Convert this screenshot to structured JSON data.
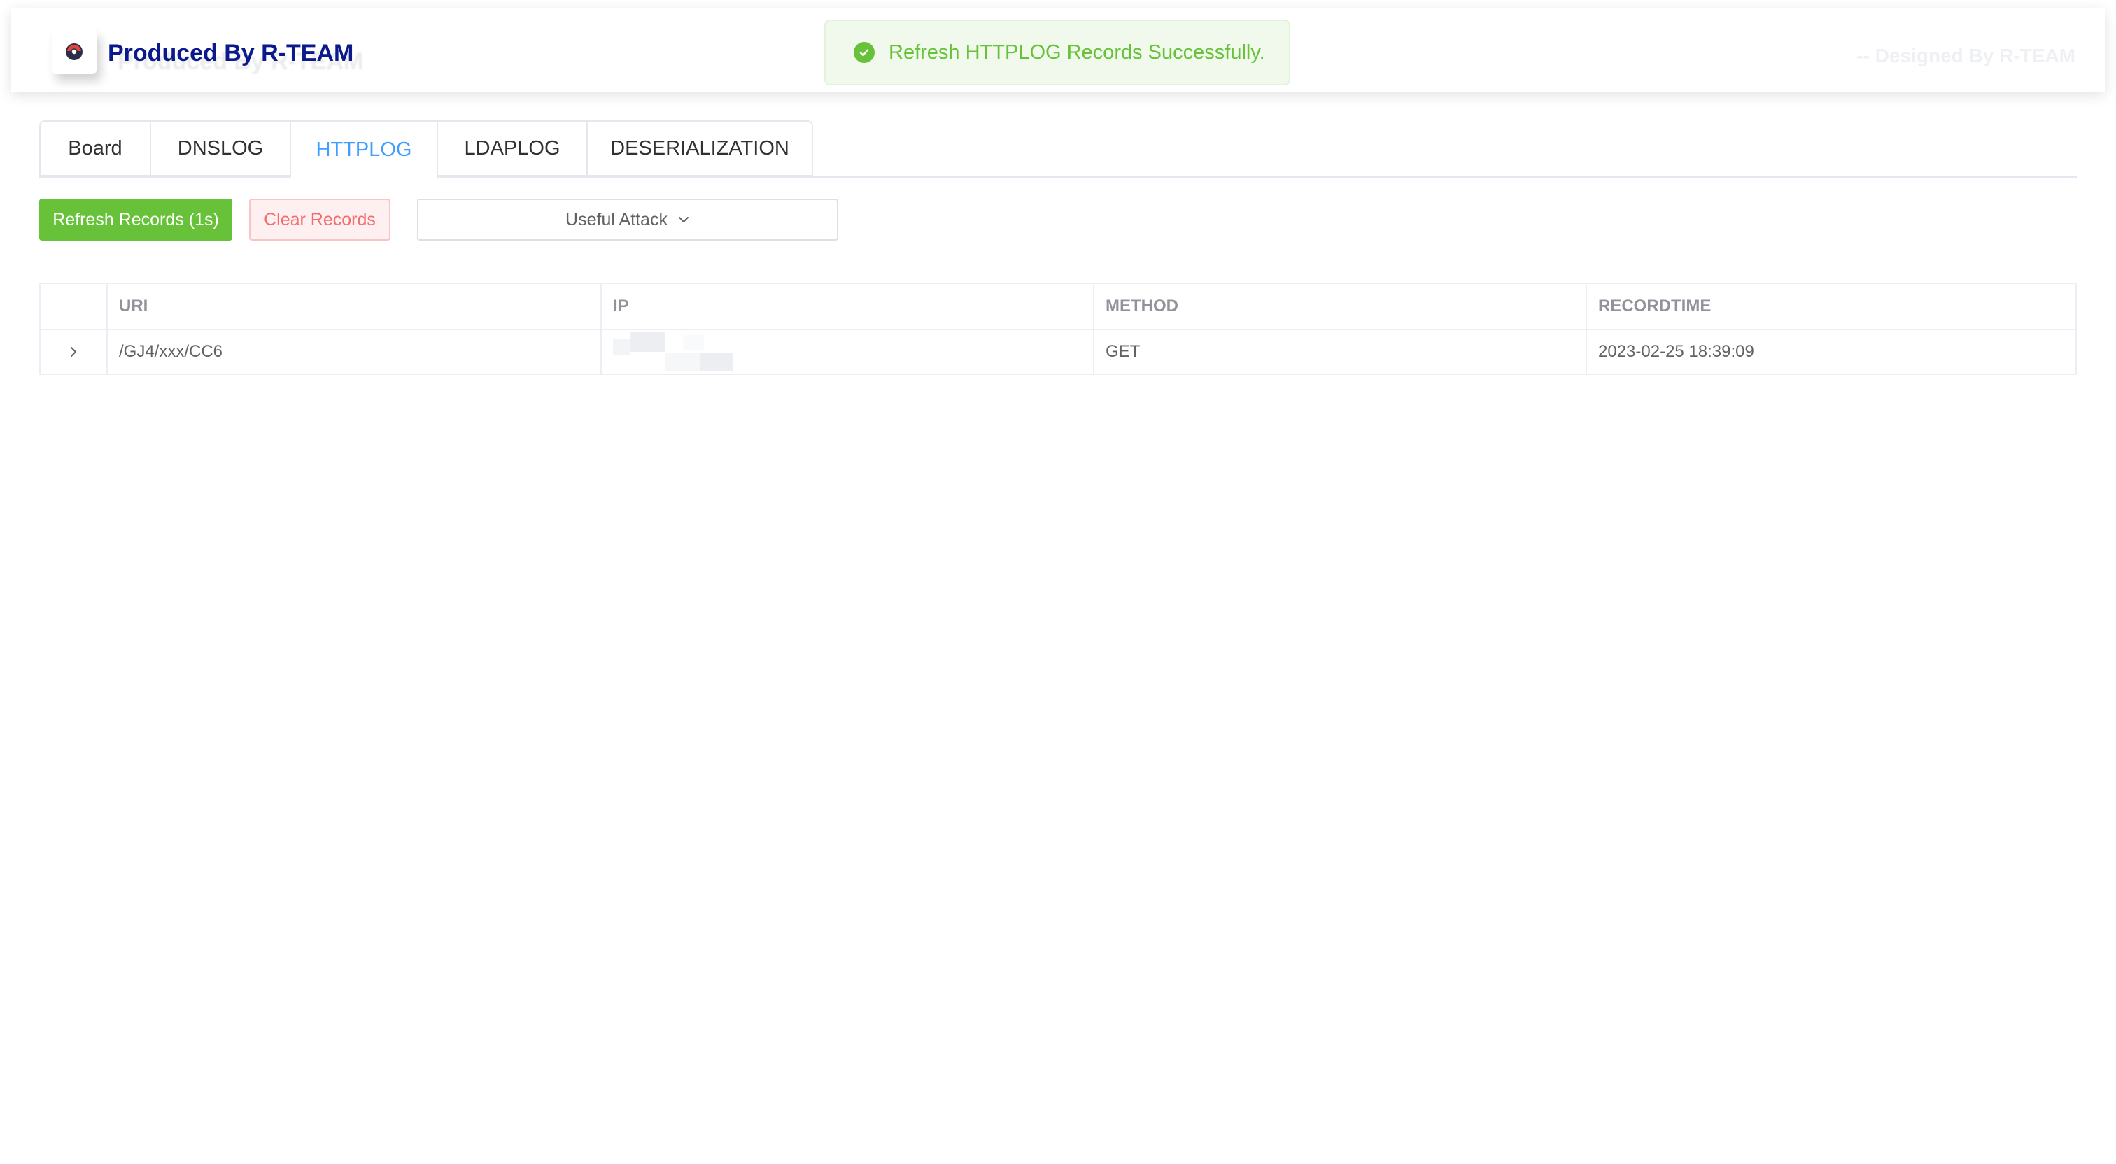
{
  "header": {
    "brand_title": "Produced By R-TEAM",
    "designed_by": "-- Designed By R-TEAM",
    "logo_icon": "pokeball-icon"
  },
  "toast": {
    "message": "Refresh HTTPLOG Records Successfully.",
    "icon": "success-check-icon",
    "color": "#67c23a"
  },
  "tabs": [
    {
      "label": "Board",
      "active": false
    },
    {
      "label": "DNSLOG",
      "active": false
    },
    {
      "label": "HTTPLOG",
      "active": true
    },
    {
      "label": "LDAPLOG",
      "active": false
    },
    {
      "label": "DESERIALIZATION",
      "active": false
    }
  ],
  "toolbar": {
    "refresh_label": "Refresh Records (1s)",
    "clear_label": "Clear Records",
    "attack_label": "Useful Attack"
  },
  "table": {
    "columns": [
      "URI",
      "IP",
      "METHOD",
      "RECORDTIME"
    ],
    "rows": [
      {
        "uri": "/GJ4/xxx/CC6",
        "ip": "",
        "method": "GET",
        "recordtime": "2023-02-25 18:39:09"
      }
    ]
  },
  "colors": {
    "accent": "#409eff",
    "success": "#67c23a",
    "danger": "#f56c6c",
    "brand": "#0a1a8c"
  }
}
